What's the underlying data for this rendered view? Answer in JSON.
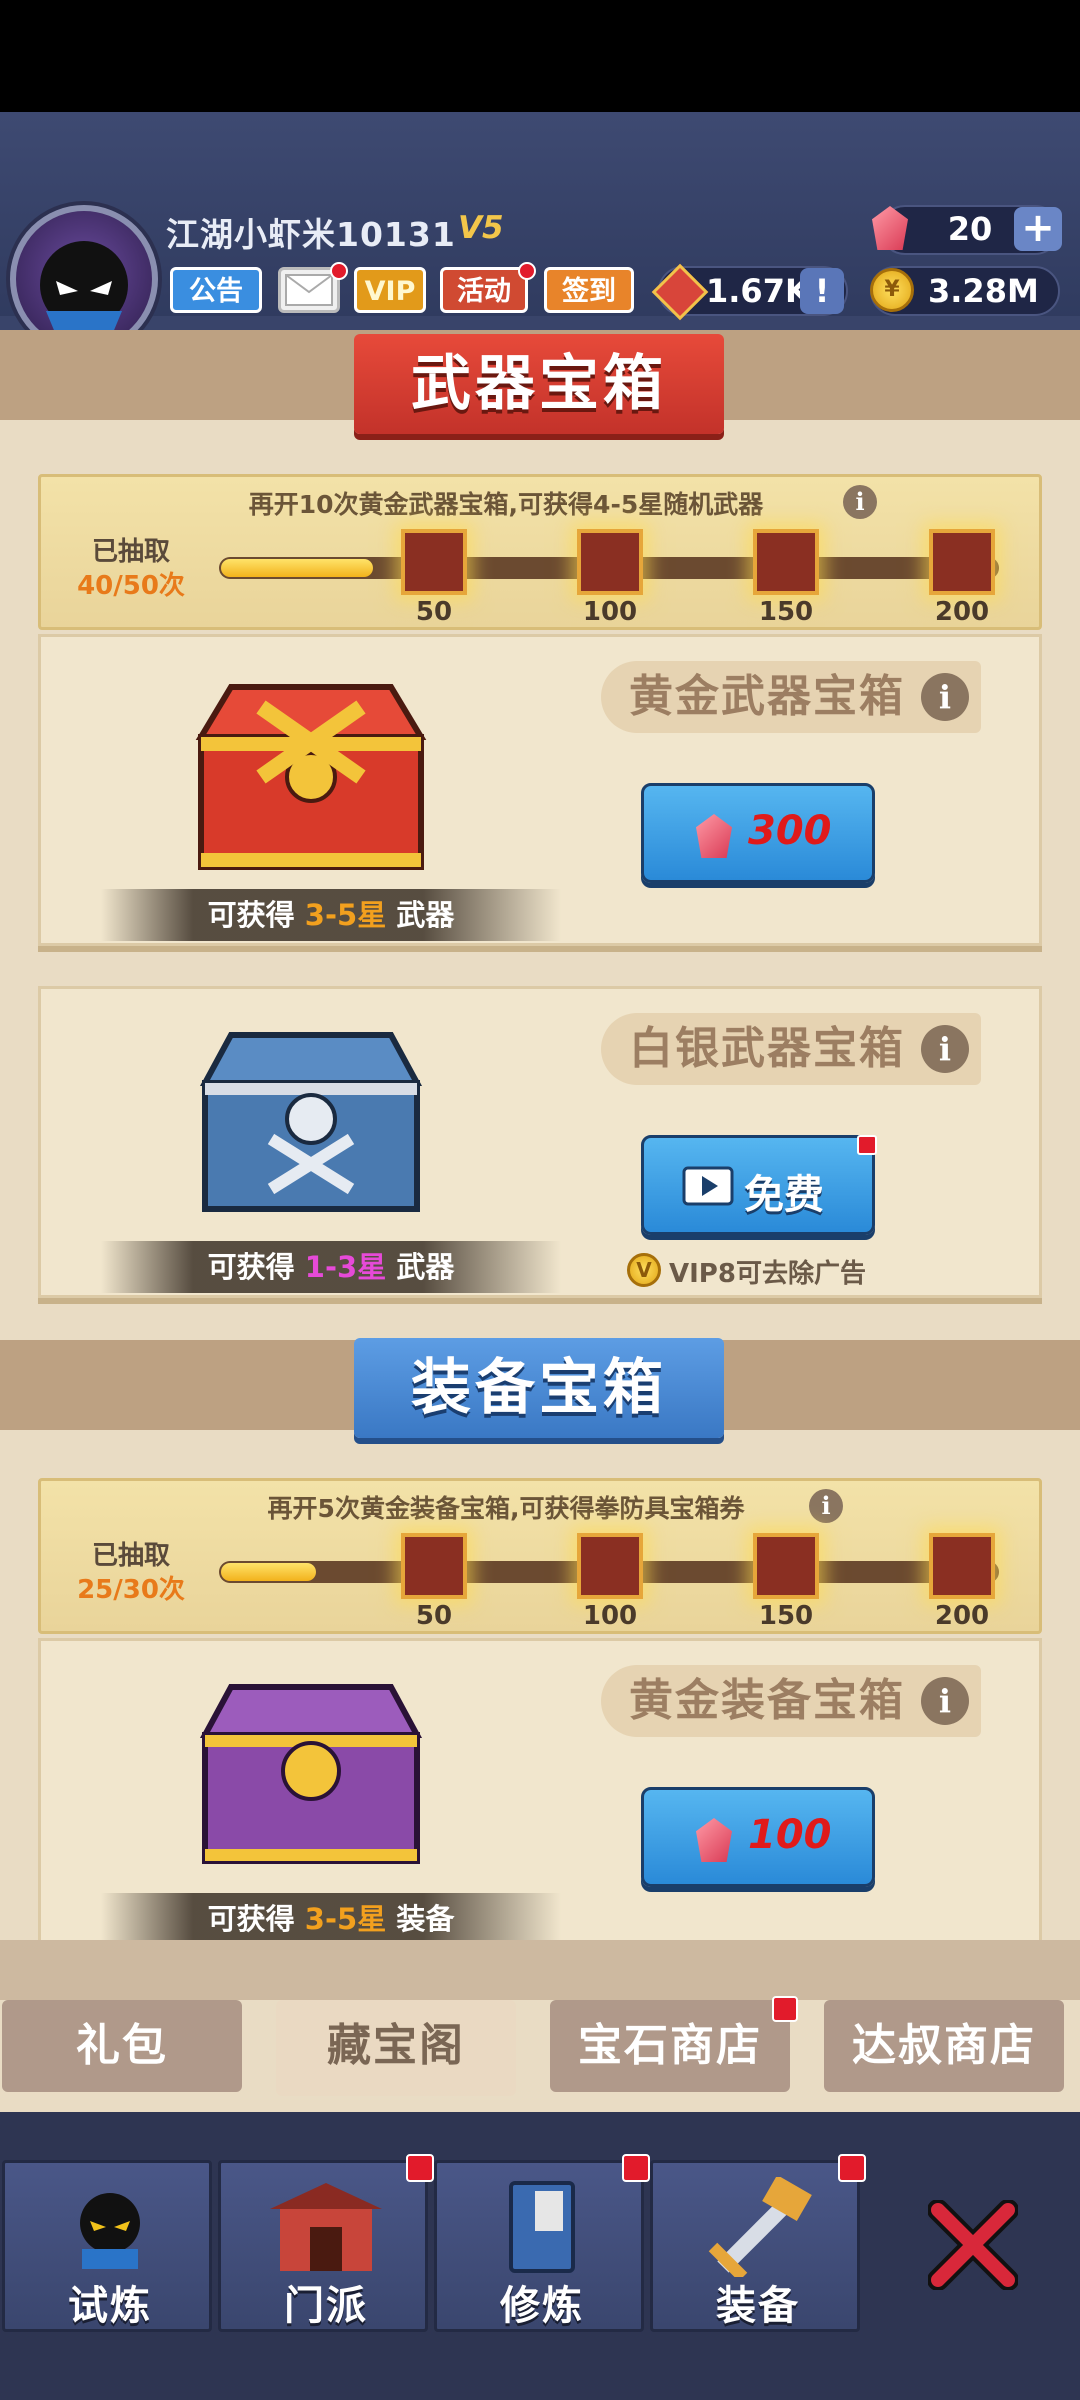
{
  "player": {
    "name": "江湖小虾米10131",
    "vip_level": "V5"
  },
  "header_buttons": {
    "notice": "公告",
    "vip": "VIP",
    "event": "活动",
    "checkin": "签到"
  },
  "resources": {
    "gems": "20",
    "tickets": "1.67K",
    "coins": "3.28M",
    "plus": "+",
    "alert": "!"
  },
  "weapon_section": {
    "title": "武器宝箱",
    "progress": {
      "hint": "再开10次黄金武器宝箱,可获得4-5星随机武器",
      "drawn_label": "已抽取",
      "drawn_count": "40/50次",
      "fill_fraction": 0.8,
      "milestones": [
        "50",
        "100",
        "150",
        "200"
      ]
    },
    "gold_chest": {
      "title": "黄金武器宝箱",
      "price": "300",
      "reward_prefix": "可获得",
      "reward_stars": "3-5星",
      "reward_suffix": "武器"
    },
    "silver_chest": {
      "title": "白银武器宝箱",
      "button_label": "免费",
      "vip_note": "VIP8可去除广告",
      "reward_prefix": "可获得",
      "reward_stars": "1-3星",
      "reward_suffix": "武器"
    }
  },
  "equip_section": {
    "title": "装备宝箱",
    "progress": {
      "hint": "再开5次黄金装备宝箱,可获得拳防具宝箱券",
      "drawn_label": "已抽取",
      "drawn_count": "25/30次",
      "fill_fraction": 0.5,
      "milestones": [
        "50",
        "100",
        "150",
        "200"
      ]
    },
    "gold_chest": {
      "title": "黄金装备宝箱",
      "price": "100",
      "reward_prefix": "可获得",
      "reward_stars": "3-5星",
      "reward_suffix": "装备"
    }
  },
  "shop_tabs": [
    "礼包",
    "藏宝阁",
    "宝石商店",
    "达叔商店"
  ],
  "active_tab": "藏宝阁",
  "bottom_nav": [
    "试炼",
    "门派",
    "修炼",
    "装备"
  ],
  "icons": {
    "info": "i",
    "vip_coin": "V",
    "coin": "¥"
  },
  "colors": {
    "accent_orange": "#f2a01e",
    "accent_purple": "#e64ad8",
    "price_red": "#e01a1a",
    "badge_red": "#e21b2b"
  }
}
